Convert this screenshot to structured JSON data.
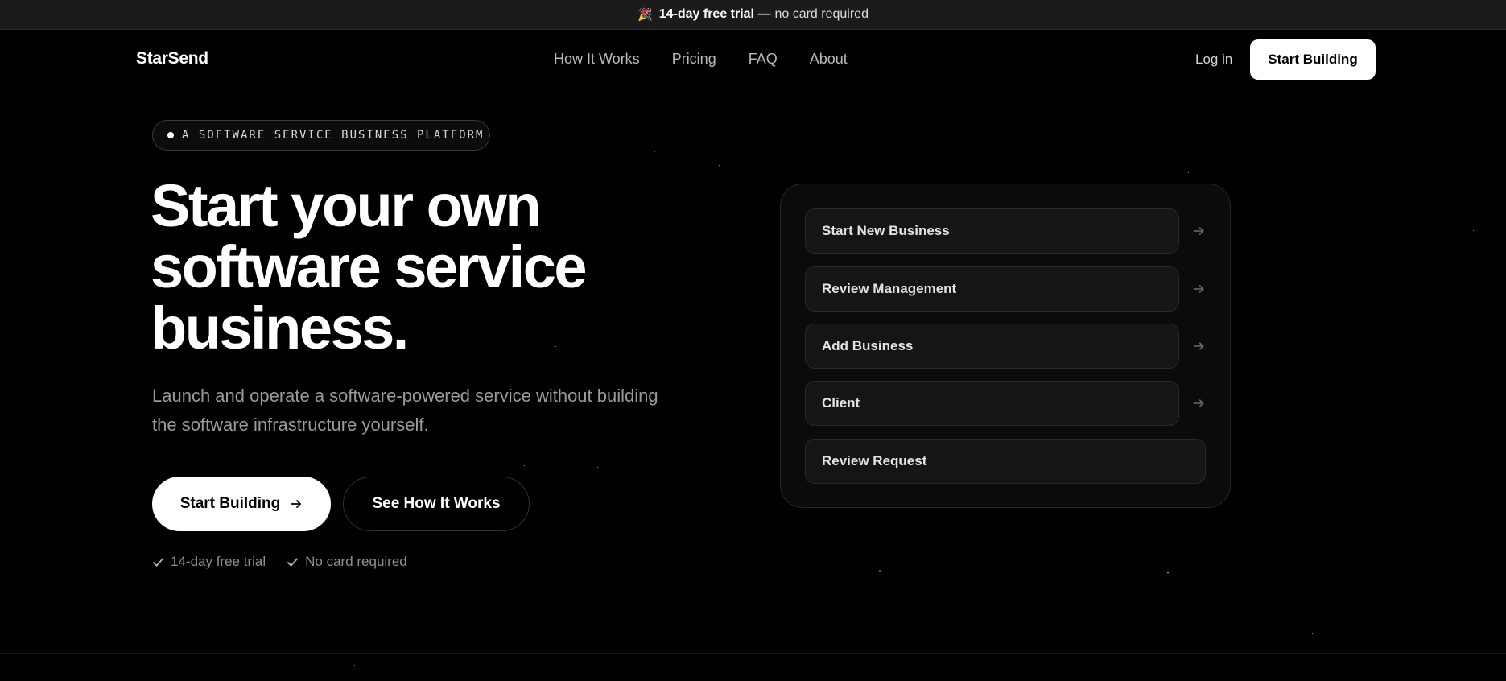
{
  "announcement": {
    "emoji": "🎉",
    "bold": "14-day free trial —",
    "rest": "no card required"
  },
  "header": {
    "logo": "StarSend",
    "nav": [
      "How It Works",
      "Pricing",
      "FAQ",
      "About"
    ],
    "login": "Log in",
    "cta": "Start Building"
  },
  "hero": {
    "pill": "A SOFTWARE SERVICE BUSINESS PLATFORM",
    "title_lines": [
      "Start your own",
      "software service",
      "business."
    ],
    "subtitle": "Launch and operate a software-powered service without building the software infrastructure yourself.",
    "primary_button": "Start Building",
    "secondary_button": "See How It Works",
    "perks": [
      "14-day free trial",
      "No card required"
    ]
  },
  "card": {
    "rows": [
      "Start New Business",
      "Review Management",
      "Add Business",
      "Client",
      "Review Request"
    ]
  },
  "icons": {
    "arrow": "arrow-right-icon",
    "check": "check-icon",
    "party": "party-popper-icon"
  }
}
